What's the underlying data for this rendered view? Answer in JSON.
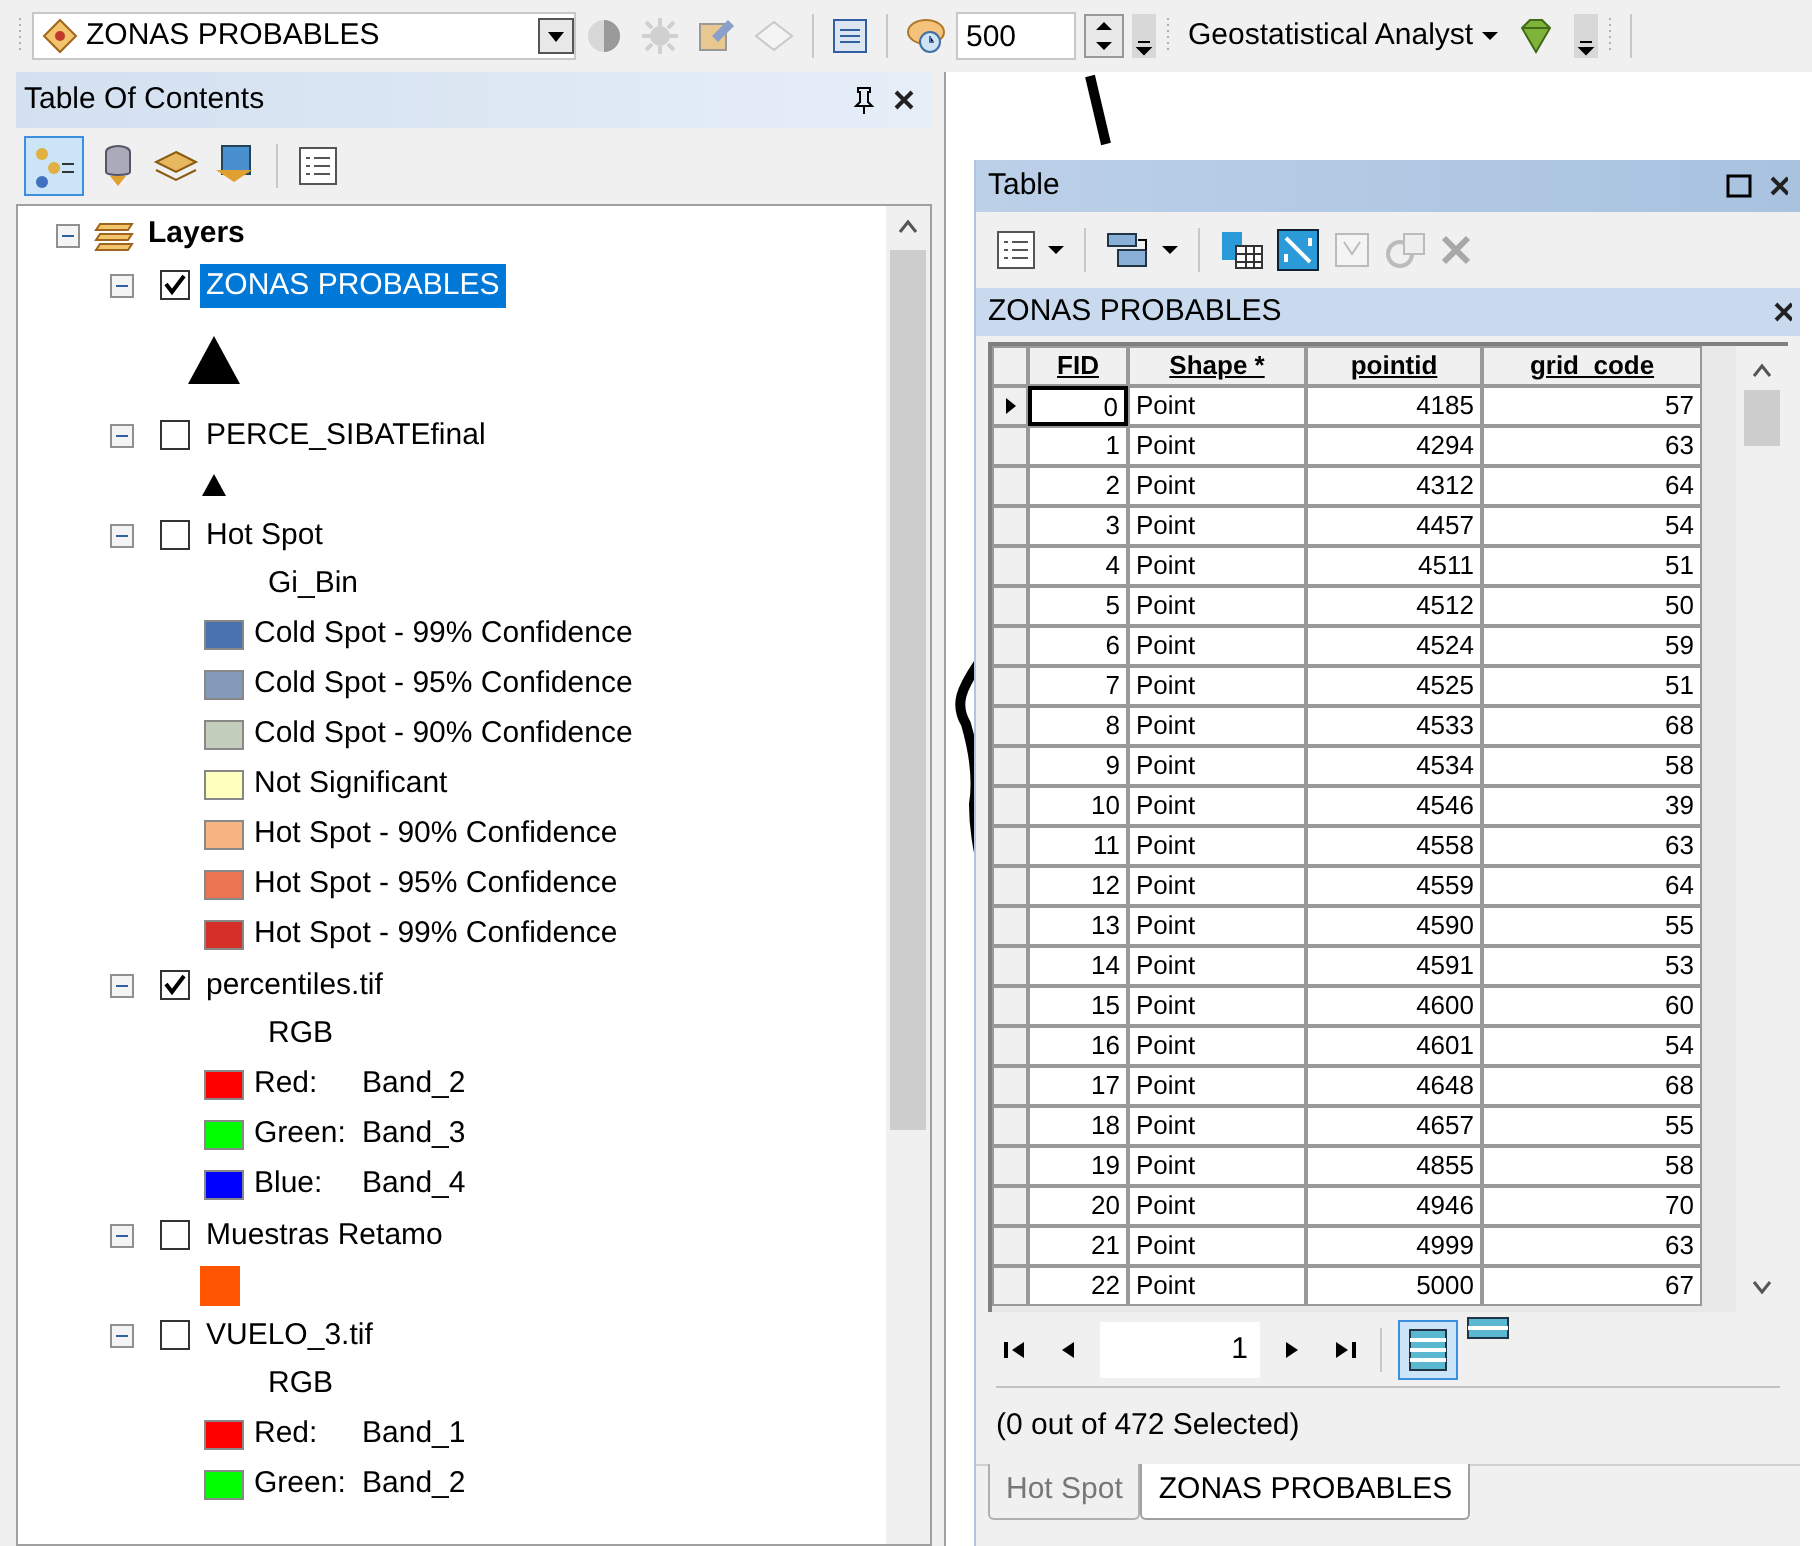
{
  "toolbar": {
    "layer_dropdown": "ZONAS PROBABLES",
    "scale": "500",
    "extension_menu": "Geostatistical Analyst"
  },
  "toc": {
    "title": "Table Of Contents",
    "tree": {
      "label": "Layers",
      "expanded": true,
      "children": [
        {
          "label": "ZONAS PROBABLES",
          "checked": true,
          "selected": true,
          "expanded": true,
          "children": [
            {
              "kind": "large_marker"
            }
          ]
        },
        {
          "label": "PERCE_SIBATEfinal",
          "checked": false,
          "selected": false,
          "expanded": true,
          "children": [
            {
              "kind": "small_marker"
            }
          ]
        },
        {
          "label": "Hot Spot",
          "checked": false,
          "selected": false,
          "expanded": true,
          "children": [
            {
              "kind": "heading",
              "label": "Gi_Bin"
            },
            {
              "kind": "swatch",
              "color": "#4a72b0",
              "label": "Cold Spot - 99% Confidence"
            },
            {
              "kind": "swatch",
              "color": "#849cba",
              "label": "Cold Spot - 95% Confidence"
            },
            {
              "kind": "swatch",
              "color": "#c2cdbc",
              "label": "Cold Spot - 90% Confidence"
            },
            {
              "kind": "swatch",
              "color": "#ffffbe",
              "label": "Not Significant"
            },
            {
              "kind": "swatch",
              "color": "#f7b482",
              "label": "Hot Spot - 90% Confidence"
            },
            {
              "kind": "swatch",
              "color": "#ec7553",
              "label": "Hot Spot - 95% Confidence"
            },
            {
              "kind": "swatch",
              "color": "#d62f27",
              "label": "Hot Spot - 99% Confidence"
            }
          ]
        },
        {
          "label": "percentiles.tif",
          "checked": true,
          "selected": false,
          "expanded": true,
          "children": [
            {
              "kind": "heading",
              "label": "RGB"
            },
            {
              "kind": "swatch",
              "color": "#ff0000",
              "label": "Red:",
              "value": "Band_2"
            },
            {
              "kind": "swatch",
              "color": "#00ff00",
              "label": "Green:",
              "value": "Band_3"
            },
            {
              "kind": "swatch",
              "color": "#0000ff",
              "label": "Blue:",
              "value": "Band_4"
            }
          ]
        },
        {
          "label": "Muestras Retamo",
          "checked": false,
          "selected": false,
          "expanded": true,
          "children": [
            {
              "kind": "fill",
              "color": "#ff5500"
            }
          ]
        },
        {
          "label": "VUELO_3.tif",
          "checked": false,
          "selected": false,
          "expanded": true,
          "children": [
            {
              "kind": "heading",
              "label": "RGB"
            },
            {
              "kind": "swatch",
              "color": "#ff0000",
              "label": "Red:",
              "value": "Band_1"
            },
            {
              "kind": "swatch",
              "color": "#00ff00",
              "label": "Green:",
              "value": "Band_2"
            }
          ]
        }
      ]
    }
  },
  "table_window": {
    "title": "Table",
    "table_title": "ZONAS PROBABLES",
    "columns": [
      "FID",
      "Shape *",
      "pointid",
      "grid_code"
    ],
    "rows": [
      {
        "current": true,
        "cells": [
          "0",
          "Point",
          "4185",
          "57"
        ]
      },
      {
        "current": false,
        "cells": [
          "1",
          "Point",
          "4294",
          "63"
        ]
      },
      {
        "current": false,
        "cells": [
          "2",
          "Point",
          "4312",
          "64"
        ]
      },
      {
        "current": false,
        "cells": [
          "3",
          "Point",
          "4457",
          "54"
        ]
      },
      {
        "current": false,
        "cells": [
          "4",
          "Point",
          "4511",
          "51"
        ]
      },
      {
        "current": false,
        "cells": [
          "5",
          "Point",
          "4512",
          "50"
        ]
      },
      {
        "current": false,
        "cells": [
          "6",
          "Point",
          "4524",
          "59"
        ]
      },
      {
        "current": false,
        "cells": [
          "7",
          "Point",
          "4525",
          "51"
        ]
      },
      {
        "current": false,
        "cells": [
          "8",
          "Point",
          "4533",
          "68"
        ]
      },
      {
        "current": false,
        "cells": [
          "9",
          "Point",
          "4534",
          "58"
        ]
      },
      {
        "current": false,
        "cells": [
          "10",
          "Point",
          "4546",
          "39"
        ]
      },
      {
        "current": false,
        "cells": [
          "11",
          "Point",
          "4558",
          "63"
        ]
      },
      {
        "current": false,
        "cells": [
          "12",
          "Point",
          "4559",
          "64"
        ]
      },
      {
        "current": false,
        "cells": [
          "13",
          "Point",
          "4590",
          "55"
        ]
      },
      {
        "current": false,
        "cells": [
          "14",
          "Point",
          "4591",
          "53"
        ]
      },
      {
        "current": false,
        "cells": [
          "15",
          "Point",
          "4600",
          "60"
        ]
      },
      {
        "current": false,
        "cells": [
          "16",
          "Point",
          "4601",
          "54"
        ]
      },
      {
        "current": false,
        "cells": [
          "17",
          "Point",
          "4648",
          "68"
        ]
      },
      {
        "current": false,
        "cells": [
          "18",
          "Point",
          "4657",
          "55"
        ]
      },
      {
        "current": false,
        "cells": [
          "19",
          "Point",
          "4855",
          "58"
        ]
      },
      {
        "current": false,
        "cells": [
          "20",
          "Point",
          "4946",
          "70"
        ]
      },
      {
        "current": false,
        "cells": [
          "21",
          "Point",
          "4999",
          "63"
        ]
      },
      {
        "current": false,
        "cells": [
          "22",
          "Point",
          "5000",
          "67"
        ]
      }
    ],
    "page": "1",
    "status": "(0 out of 472 Selected)",
    "tabs": [
      {
        "label": "Hot Spot",
        "selected": false
      },
      {
        "label": "ZONAS PROBABLES",
        "selected": true
      }
    ]
  }
}
